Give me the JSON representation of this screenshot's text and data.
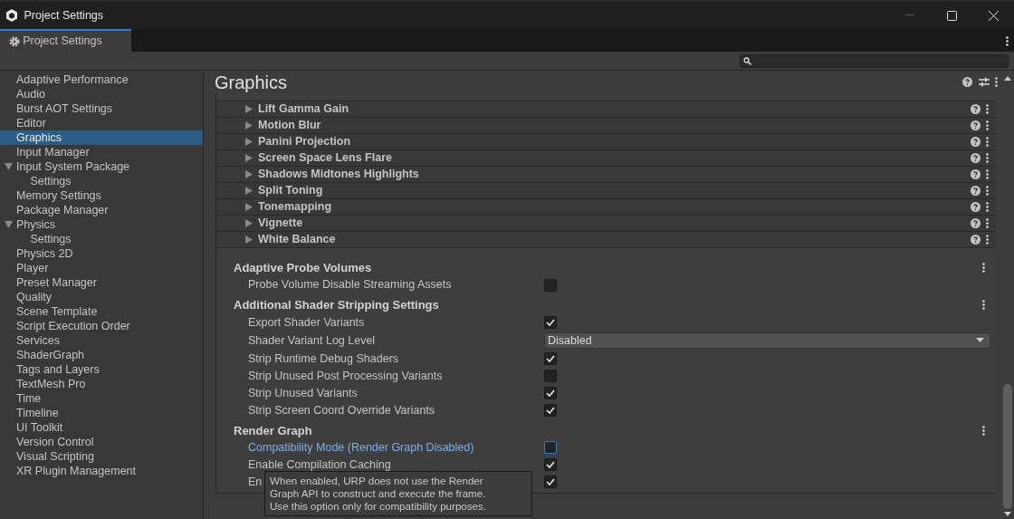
{
  "window": {
    "title": "Project Settings"
  },
  "tab": {
    "label": "Project Settings",
    "selected": true
  },
  "sidebar": {
    "items": [
      {
        "label": "Adaptive Performance",
        "selected": false
      },
      {
        "label": "Audio",
        "selected": false
      },
      {
        "label": "Burst AOT Settings",
        "selected": false
      },
      {
        "label": "Editor",
        "selected": false
      },
      {
        "label": "Graphics",
        "selected": true
      },
      {
        "label": "Input Manager",
        "selected": false
      },
      {
        "label": "Input System Package",
        "selected": false,
        "expanded": true,
        "children": [
          {
            "label": "Settings",
            "selected": false
          }
        ]
      },
      {
        "label": "Memory Settings",
        "selected": false
      },
      {
        "label": "Package Manager",
        "selected": false
      },
      {
        "label": "Physics",
        "selected": false,
        "expanded": true,
        "children": [
          {
            "label": "Settings",
            "selected": false
          }
        ]
      },
      {
        "label": "Physics 2D",
        "selected": false
      },
      {
        "label": "Player",
        "selected": false
      },
      {
        "label": "Preset Manager",
        "selected": false
      },
      {
        "label": "Quality",
        "selected": false
      },
      {
        "label": "Scene Template",
        "selected": false
      },
      {
        "label": "Script Execution Order",
        "selected": false
      },
      {
        "label": "Services",
        "selected": false
      },
      {
        "label": "ShaderGraph",
        "selected": false
      },
      {
        "label": "Tags and Layers",
        "selected": false
      },
      {
        "label": "TextMesh Pro",
        "selected": false
      },
      {
        "label": "Time",
        "selected": false
      },
      {
        "label": "Timeline",
        "selected": false
      },
      {
        "label": "UI Toolkit",
        "selected": false
      },
      {
        "label": "Version Control",
        "selected": false
      },
      {
        "label": "Visual Scripting",
        "selected": false
      },
      {
        "label": "XR Plugin Management",
        "selected": false
      }
    ]
  },
  "inspector": {
    "title": "Graphics",
    "volume_overrides": [
      "Lift Gamma Gain",
      "Motion Blur",
      "Panini Projection",
      "Screen Space Lens Flare",
      "Shadows Midtones Highlights",
      "Split Toning",
      "Tonemapping",
      "Vignette",
      "White Balance"
    ],
    "sections": [
      {
        "title": "Adaptive Probe Volumes",
        "rows": [
          {
            "kind": "checkbox",
            "label": "Probe Volume Disable Streaming Assets",
            "checked": false,
            "focused": false
          }
        ]
      },
      {
        "title": "Additional Shader Stripping Settings",
        "rows": [
          {
            "kind": "checkbox",
            "label": "Export Shader Variants",
            "checked": true,
            "focused": false
          },
          {
            "kind": "dropdown",
            "label": "Shader Variant Log Level",
            "value": "Disabled"
          },
          {
            "kind": "checkbox",
            "label": "Strip Runtime Debug Shaders",
            "checked": true,
            "focused": false
          },
          {
            "kind": "checkbox",
            "label": "Strip Unused Post Processing Variants",
            "checked": false,
            "focused": false
          },
          {
            "kind": "checkbox",
            "label": "Strip Unused Variants",
            "checked": true,
            "focused": false
          },
          {
            "kind": "checkbox",
            "label": "Strip Screen Coord Override Variants",
            "checked": true,
            "focused": false
          }
        ]
      },
      {
        "title": "Render Graph",
        "rows": [
          {
            "kind": "checkbox",
            "label": "Compatibility Mode (Render Graph Disabled)",
            "checked": false,
            "focused": true
          },
          {
            "kind": "checkbox",
            "label": "Enable Compilation Caching",
            "checked": true,
            "focused": false
          },
          {
            "kind": "checkbox",
            "label": "En",
            "checked": true,
            "focused": false
          }
        ]
      }
    ]
  },
  "tooltip": {
    "text": "When enabled, URP does not use the Render Graph API to construct and execute the frame. Use this option only for compatibility purposes."
  }
}
